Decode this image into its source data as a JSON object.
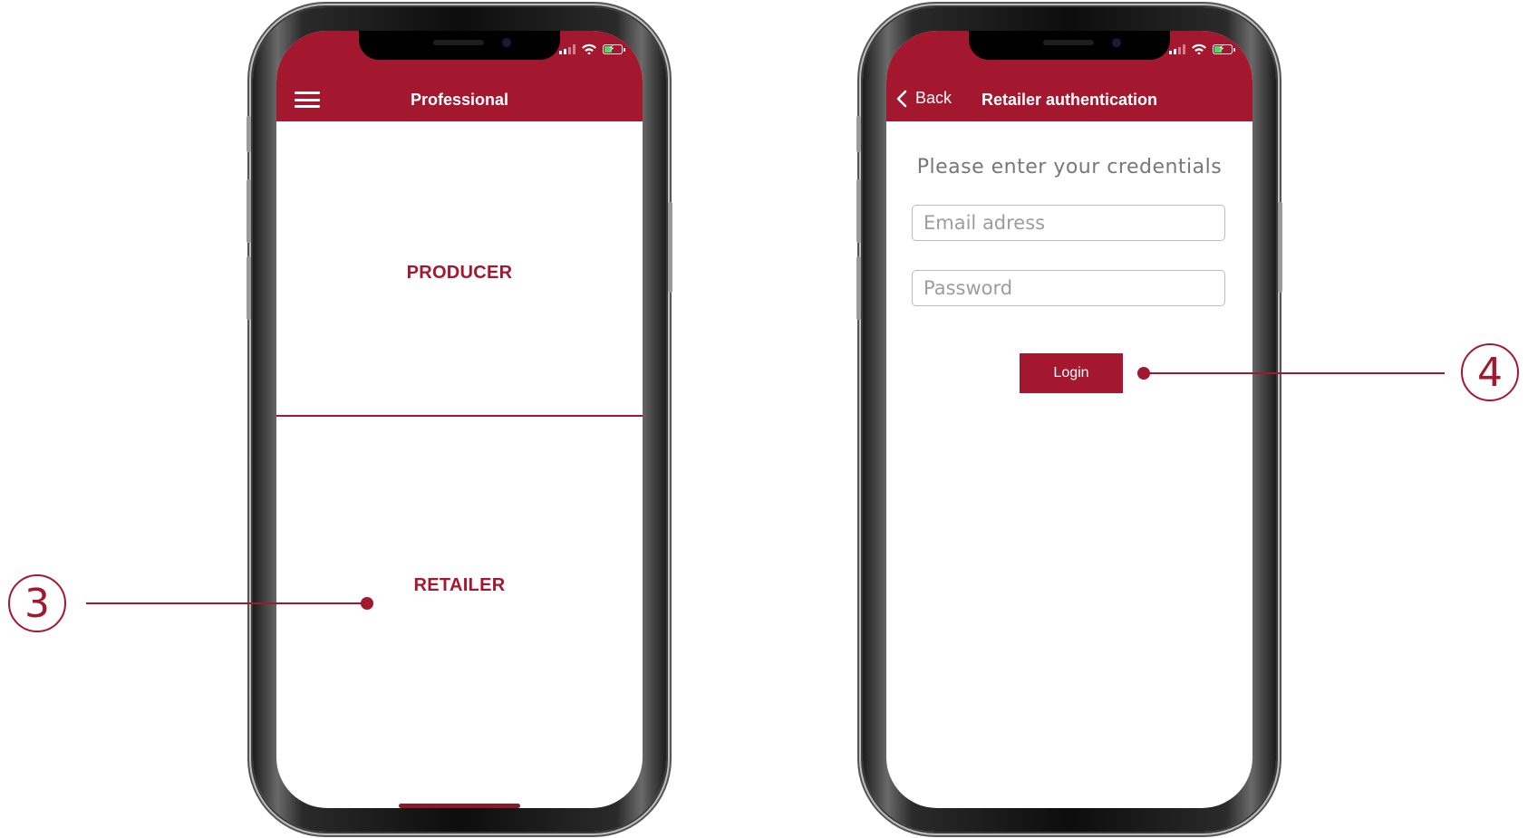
{
  "colors": {
    "brand": "#a4182f",
    "header_text": "#ffffff",
    "placeholder": "#9d9d9d"
  },
  "left_phone": {
    "header": {
      "title": "Professional",
      "menu_icon": "hamburger-menu-icon"
    },
    "options": {
      "producer": "PRODUCER",
      "retailer": "RETAILER"
    }
  },
  "right_phone": {
    "header": {
      "back_label": "Back",
      "title": "Retailer authentication"
    },
    "prompt": "Please enter your credentials",
    "email_placeholder": "Email adress",
    "password_placeholder": "Password",
    "login_label": "Login"
  },
  "callouts": {
    "retailer_step": "3",
    "login_step": "4"
  }
}
